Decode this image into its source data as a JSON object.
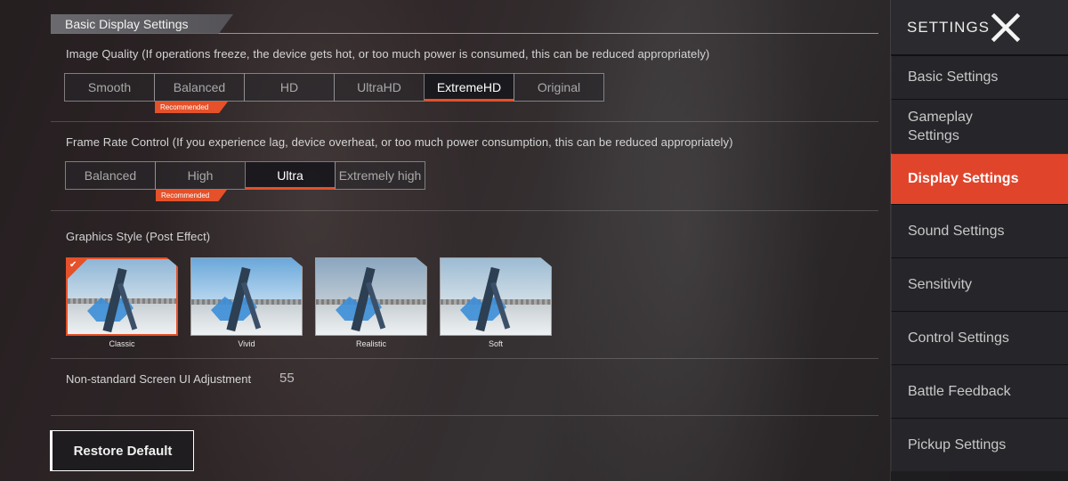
{
  "section": {
    "title": "Basic Display Settings"
  },
  "image_quality": {
    "label": "Image Quality (If operations freeze, the device gets hot, or too much power is consumed, this can be reduced appropriately)",
    "options": [
      "Smooth",
      "Balanced",
      "HD",
      "UltraHD",
      "ExtremeHD",
      "Original"
    ],
    "selected": "ExtremeHD",
    "recommended_badge": "Recommended"
  },
  "frame_rate": {
    "label": "Frame Rate Control (If you experience lag, device overheat, or too much power consumption, this can be reduced appropriately)",
    "options": [
      "Balanced",
      "High",
      "Ultra",
      "Extremely high"
    ],
    "selected": "Ultra",
    "recommended_badge": "Recommended"
  },
  "graphics_style": {
    "label": "Graphics Style (Post Effect)",
    "styles": [
      "Classic",
      "Vivid",
      "Realistic",
      "Soft"
    ],
    "selected": "Classic"
  },
  "ui_adjustment": {
    "label": "Non-standard Screen UI Adjustment",
    "value": "55"
  },
  "restore_button": "Restore Default",
  "sidebar": {
    "title": "SETTINGS",
    "close_icon": "close-icon",
    "items": [
      "Basic Settings",
      "Gameplay Settings",
      "Display Settings",
      "Sound Settings",
      "Sensitivity",
      "Control Settings",
      "Battle Feedback",
      "Pickup Settings"
    ],
    "active_index": 2
  },
  "colors": {
    "accent": "#e4512a",
    "sidebar_active": "#e0452c"
  }
}
